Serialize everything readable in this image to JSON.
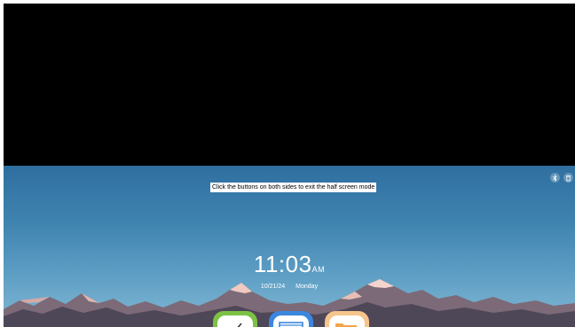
{
  "hint": {
    "text": "Click the buttons on both sides to exit the half screen mode"
  },
  "side_buttons": [
    {
      "icon": "bluetooth-icon"
    },
    {
      "icon": "trash-icon"
    }
  ],
  "clock": {
    "time": "11:03",
    "ampm": "AM",
    "date": "10/21/24",
    "weekday": "Monday"
  },
  "dock": {
    "apps": [
      {
        "icon": "note-pen-icon",
        "color": "#7cc244"
      },
      {
        "icon": "whiteboard-icon",
        "color": "#3b86de"
      },
      {
        "icon": "folder-icon",
        "color": "#f6c58c"
      }
    ]
  },
  "colors": {
    "top_panel": "#000000",
    "sky_top": "#2f6fa0",
    "sky_bottom": "#82b9d4"
  }
}
